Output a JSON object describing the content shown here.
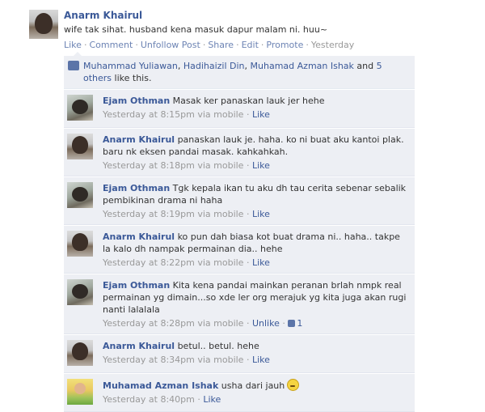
{
  "post": {
    "author": "Anarm Khairul",
    "message": "wife tak sihat. husband kena masuk dapur malam ni. huu~",
    "actions": [
      "Like",
      "Comment",
      "Unfollow Post",
      "Share",
      "Edit",
      "Promote"
    ],
    "separator": "·",
    "timestamp": "Yesterday"
  },
  "likes": {
    "names": [
      "Muhammad Yuliawan",
      "Hadihaizil Din",
      "Muhamad Azman Ishak"
    ],
    "comma": ",",
    "and_word": "and",
    "others_link": "5 others",
    "suffix": "like this."
  },
  "comments": [
    {
      "author": "Ejam Othman",
      "text": "Masak ker panaskan lauk jer hehe",
      "time": "Yesterday at 8:15pm via mobile",
      "action": "Like"
    },
    {
      "author": "Anarm Khairul",
      "text": "panaskan lauk je. haha. ko ni buat aku kantoi plak. baru nk eksen pandai masak. kahkahkah.",
      "time": "Yesterday at 8:18pm via mobile",
      "action": "Like"
    },
    {
      "author": "Ejam Othman",
      "text": "Tgk kepala ikan tu aku dh tau cerita sebenar sebalik pembikinan drama ni haha",
      "time": "Yesterday at 8:19pm via mobile",
      "action": "Like"
    },
    {
      "author": "Anarm Khairul",
      "text": "ko pun dah biasa kot buat drama ni.. haha.. takpe la kalo dh nampak permainan dia.. hehe",
      "time": "Yesterday at 8:22pm via mobile",
      "action": "Like"
    },
    {
      "author": "Ejam Othman",
      "text": "Kita kena pandai mainkan peranan brlah nmpk real permainan yg dimain...so xde ler org merajuk yg kita juga akan rugi nanti lalalala",
      "time": "Yesterday at 8:28pm via mobile",
      "action": "Unlike",
      "like_count": "1"
    },
    {
      "author": "Anarm Khairul",
      "text": "betul.. betul. hehe",
      "time": "Yesterday at 8:34pm via mobile",
      "action": "Like"
    },
    {
      "author": "Muhamad Azman Ishak",
      "text": "usha dari jauh",
      "time": "Yesterday at 8:40pm",
      "action": "Like",
      "emoji": "worried-smiley"
    }
  ],
  "meta_separator": "·"
}
